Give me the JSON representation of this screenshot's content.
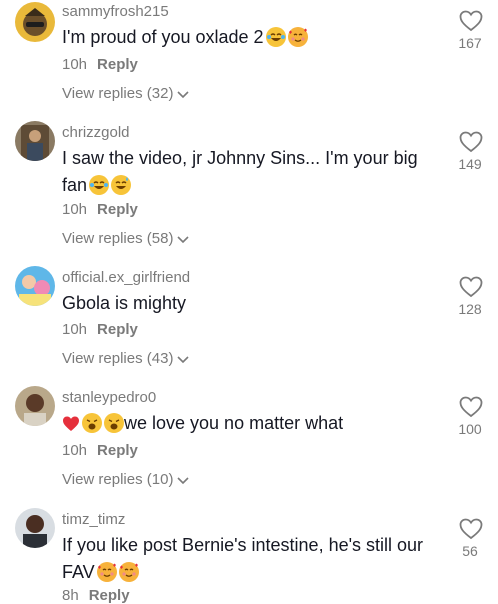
{
  "comments": [
    {
      "username": "sammyfrosh215",
      "text": "I'm proud of you oxlade 2",
      "emojis_after": [
        "laughing-tears-emoji",
        "smiling-hearts-emoji"
      ],
      "time": "10h",
      "reply_label": "Reply",
      "view_replies": "View replies (32)",
      "likes": "167"
    },
    {
      "username": "chrizzgold",
      "text": "I saw the video, jr Johnny Sins... I'm your big fan",
      "emojis_after": [
        "laughing-tears-emoji",
        "grinning-sweat-emoji"
      ],
      "time": "10h",
      "reply_label": "Reply",
      "view_replies": "View replies (58)",
      "likes": "149"
    },
    {
      "username": "official.ex_girlfriend",
      "text": "Gbola is mighty",
      "time": "10h",
      "reply_label": "Reply",
      "view_replies": "View replies (43)",
      "likes": "128"
    },
    {
      "username": "stanleypedro0",
      "text": "we love you no matter what",
      "emojis_before": [
        "red-heart-emoji",
        "weary-face-emoji",
        "weary-face-emoji"
      ],
      "time": "10h",
      "reply_label": "Reply",
      "view_replies": "View replies (10)",
      "likes": "100"
    },
    {
      "username": "timz_timz",
      "text": "If you like post Bernie's intestine, he's still our FAV",
      "emojis_after": [
        "smiling-hearts-emoji",
        "smiling-hearts-emoji"
      ],
      "time": "8h",
      "reply_label": "Reply",
      "likes": "56"
    }
  ],
  "colors": {
    "text": "#161823",
    "muted": "#7a7a7a",
    "background": "#ffffff"
  }
}
